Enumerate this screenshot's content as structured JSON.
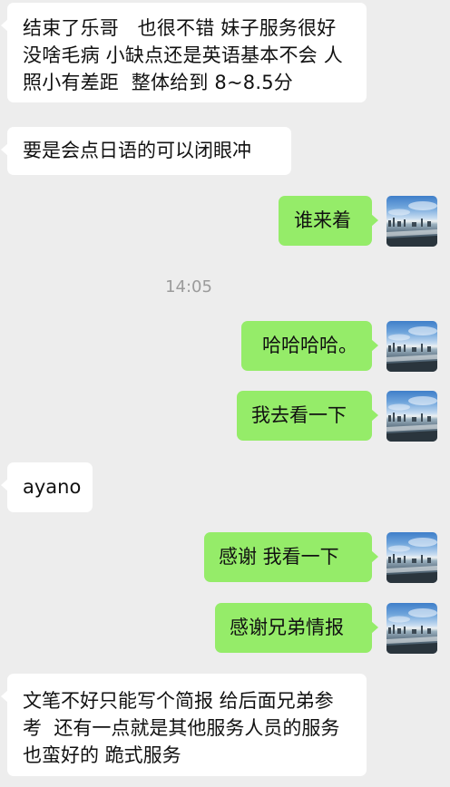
{
  "messages": [
    {
      "side": "left",
      "text": "结束了乐哥   也很不错 妹子服务很好没啥毛病 小缺点还是英语基本不会 人照小有差距  整体给到 8~8.5分"
    },
    {
      "side": "left",
      "text": "要是会点日语的可以闭眼冲"
    },
    {
      "side": "right",
      "text": "谁来着"
    },
    {
      "type": "time",
      "text": "14:05"
    },
    {
      "side": "right",
      "text": "哈哈哈哈。"
    },
    {
      "side": "right",
      "text": "我去看一下"
    },
    {
      "side": "left",
      "text": "ayano"
    },
    {
      "side": "right",
      "text": "感谢 我看一下"
    },
    {
      "side": "right",
      "text": "感谢兄弟情报"
    },
    {
      "side": "left",
      "text": "文笔不好只能写个简报 给后面兄弟参考  还有一点就是其他服务人员的服务也蛮好的 跪式服务"
    }
  ],
  "colors": {
    "background": "#ededed",
    "bubble_left": "#ffffff",
    "bubble_right": "#95ec69",
    "timestamp": "#9b9b9b"
  },
  "icons": {
    "avatar": "city-skyline-avatar"
  }
}
